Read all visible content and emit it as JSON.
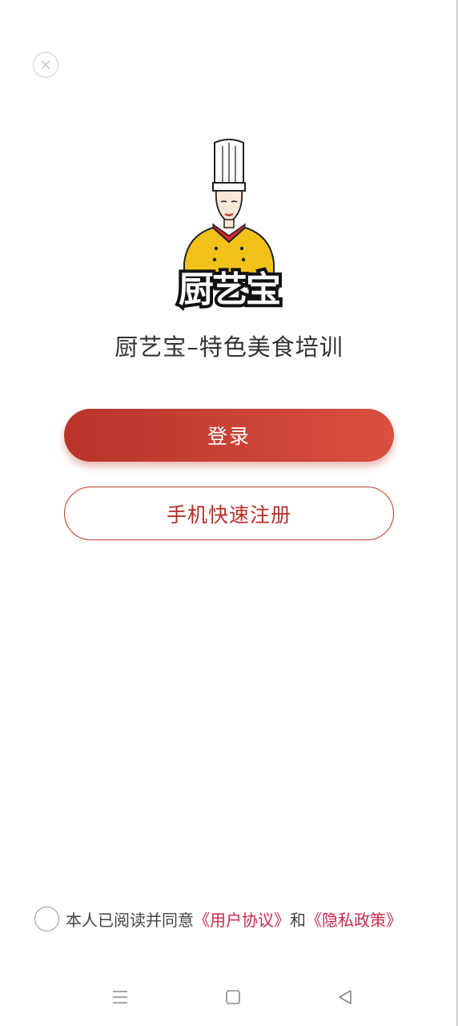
{
  "header": {
    "close_icon": "close-circle-icon"
  },
  "logo": {
    "text": "厨艺宝",
    "icon": "chef-logo"
  },
  "app_title": "厨艺宝–特色美食培训",
  "buttons": {
    "login_label": "登录",
    "register_label": "手机快速注册"
  },
  "agreement": {
    "checked": false,
    "prefix": "本人已阅读并同意",
    "user_agreement": "《用户协议》",
    "conjunction": "和",
    "privacy_policy": "《隐私政策》"
  },
  "navbar": {
    "icons": [
      "menu-icon",
      "home-icon",
      "back-icon"
    ]
  },
  "colors": {
    "accent": "#c0392b",
    "link": "#c8284b",
    "chef_jacket": "#f2c21b"
  }
}
